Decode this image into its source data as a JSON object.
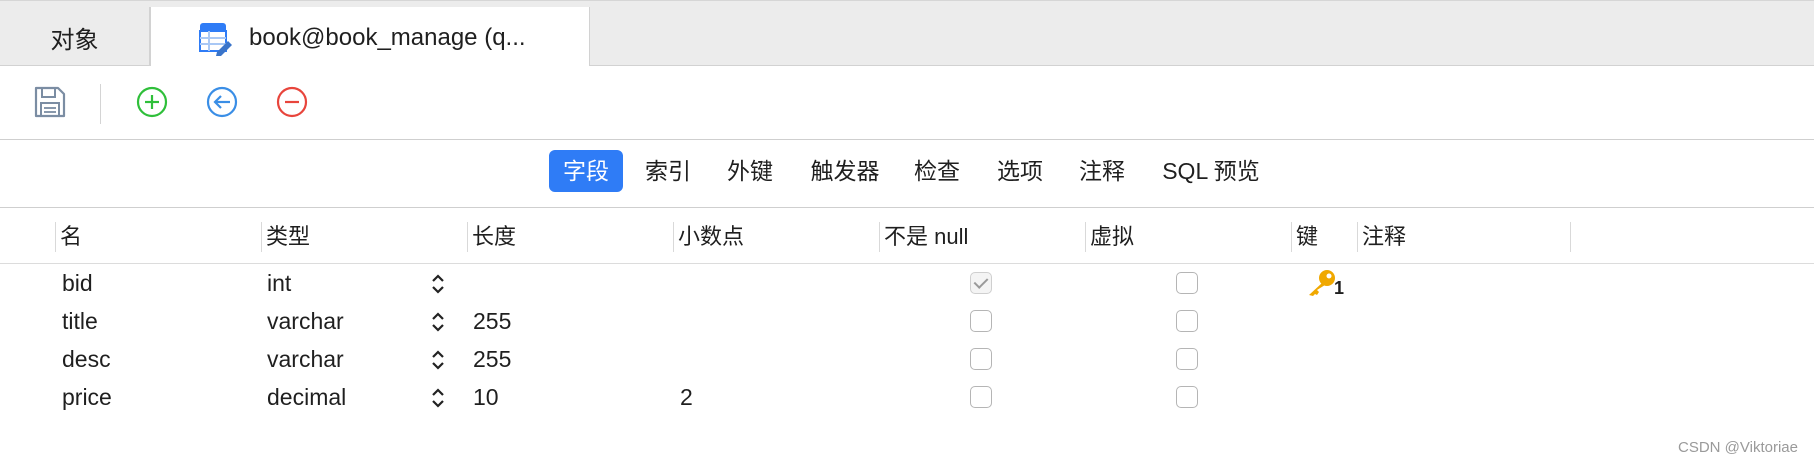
{
  "tabs": [
    {
      "label": "对象"
    },
    {
      "label": "book@book_manage (q..."
    }
  ],
  "toolbar": {
    "save_icon": "save-icon",
    "add_icon": "add-icon",
    "insert_icon": "insert-left-icon",
    "remove_icon": "remove-icon"
  },
  "segments": [
    "字段",
    "索引",
    "外键",
    "触发器",
    "检查",
    "选项",
    "注释",
    "SQL 预览"
  ],
  "columns": [
    "名",
    "类型",
    "长度",
    "小数点",
    "不是 null",
    "虚拟",
    "键",
    "注释"
  ],
  "rows": [
    {
      "name": "bid",
      "type": "int",
      "length": "",
      "decimals": "",
      "not_null": true,
      "virtual": false,
      "key": "1"
    },
    {
      "name": "title",
      "type": "varchar",
      "length": "255",
      "decimals": "",
      "not_null": false,
      "virtual": false,
      "key": ""
    },
    {
      "name": "desc",
      "type": "varchar",
      "length": "255",
      "decimals": "",
      "not_null": false,
      "virtual": false,
      "key": ""
    },
    {
      "name": "price",
      "type": "decimal",
      "length": "10",
      "decimals": "2",
      "not_null": false,
      "virtual": false,
      "key": ""
    }
  ],
  "colors": {
    "accent": "#2f7cf6",
    "add": "#2fbf3a",
    "insert": "#3a8ee6",
    "remove": "#e8453c",
    "key": "#f0a800"
  },
  "watermark": "CSDN @Viktoriae"
}
